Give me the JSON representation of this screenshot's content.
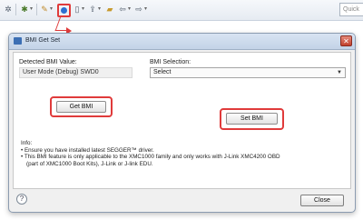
{
  "toolbar": {
    "icons": [
      "gear-icon",
      "debug-icon",
      "bmi-icon",
      "page-icon",
      "launch-icon",
      "back-icon",
      "forward-icon"
    ],
    "quick_access": "Quick"
  },
  "dialog": {
    "title": "BMI Get Set",
    "close_glyph": "✕",
    "detected_label": "Detected BMI Value:",
    "detected_value": "User Mode (Debug) SWD0",
    "selection_label": "BMI Selection:",
    "selection_value": "Select",
    "get_button": "Get BMI",
    "set_button": "Set BMI",
    "info_title": "Info:",
    "info_lines": [
      "• Ensure you have installed latest SEGGER™ driver.",
      "• This BMI feature is only applicable to the XMC1000 family and only works with J-Link XMC4200 OBD",
      "  (part of XMC1000 Boot Kits), J-Link or J-link EDU."
    ],
    "help_glyph": "?",
    "close_button": "Close"
  },
  "colors": {
    "highlight": "#e03b3b",
    "title_bar": "#c3d3e7"
  }
}
